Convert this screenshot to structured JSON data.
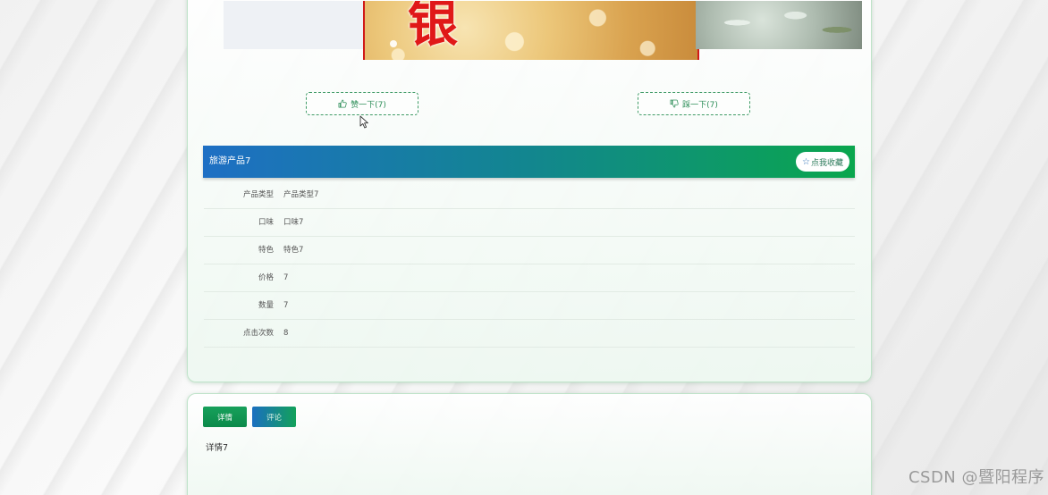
{
  "vote": {
    "like_label": "赞一下(7)",
    "dislike_label": "踩一下(7)"
  },
  "product": {
    "title": "旅游产品7",
    "favorite_label": "点我收藏",
    "details": [
      {
        "label": "产品类型",
        "value": "产品类型7"
      },
      {
        "label": "口味",
        "value": "口味7"
      },
      {
        "label": "特色",
        "value": "特色7"
      },
      {
        "label": "价格",
        "value": "7"
      },
      {
        "label": "数量",
        "value": "7"
      },
      {
        "label": "点击次数",
        "value": "8"
      }
    ]
  },
  "tabs": {
    "detail_label": "详情",
    "comment_label": "评论",
    "content": "详情7"
  },
  "carousel": {
    "slide_char": "银"
  },
  "watermark": "CSDN @暨阳程序"
}
